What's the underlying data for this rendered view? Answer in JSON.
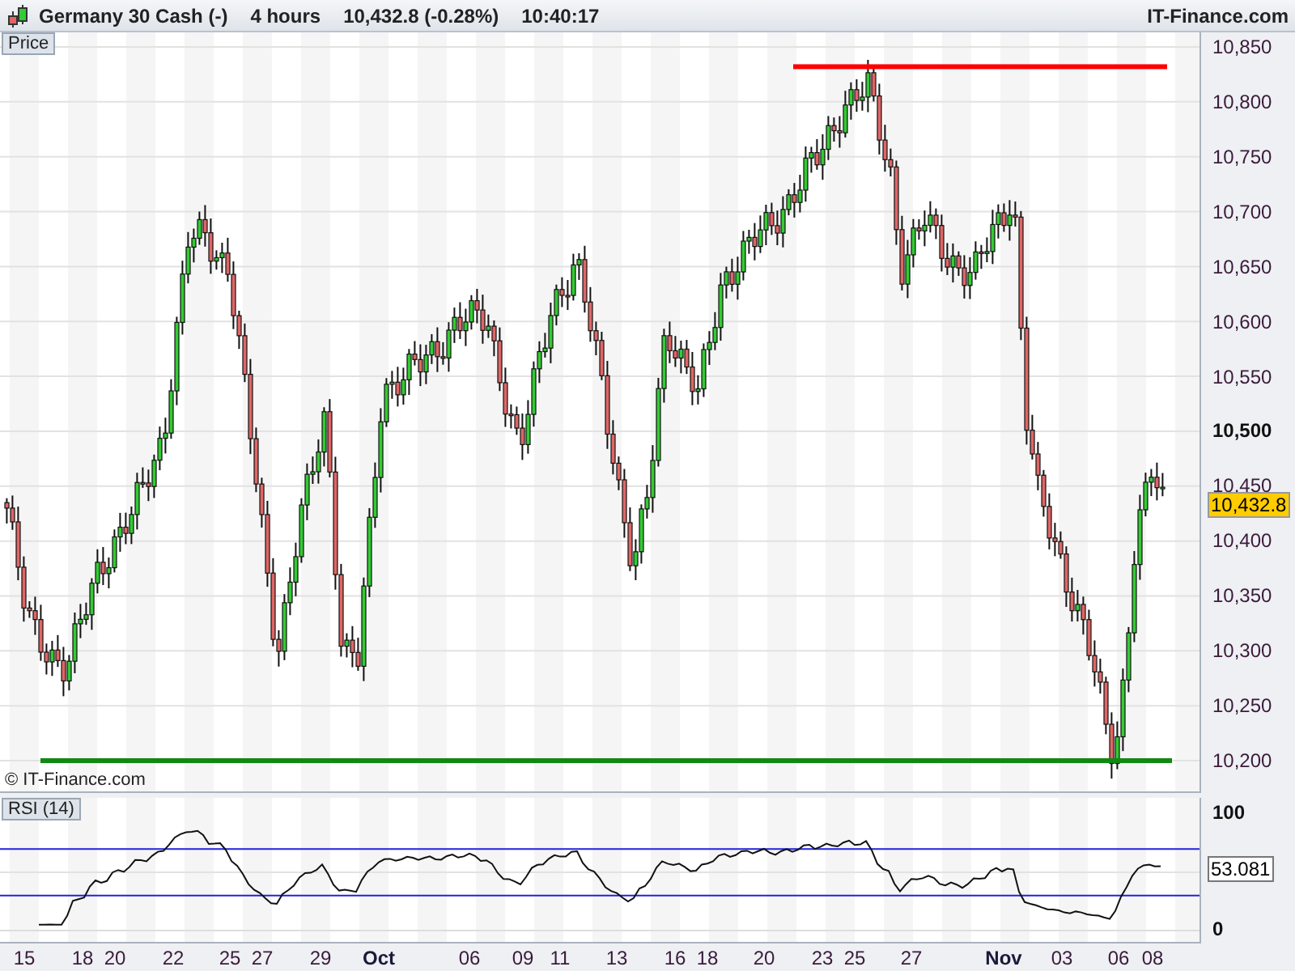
{
  "header": {
    "instrument": "Germany 30 Cash (-)",
    "timeframe": "4 hours",
    "quote": "10,432.8 (-0.28%)",
    "time": "10:40:17",
    "brand": "IT-Finance.com"
  },
  "price_panel": {
    "label": "Price",
    "copyright": "© IT-Finance.com",
    "current_price": "10,432.8",
    "y_ticks": [
      {
        "label": "10,850",
        "bold": false
      },
      {
        "label": "10,800",
        "bold": false
      },
      {
        "label": "10,750",
        "bold": false
      },
      {
        "label": "10,700",
        "bold": false
      },
      {
        "label": "10,650",
        "bold": false
      },
      {
        "label": "10,600",
        "bold": false
      },
      {
        "label": "10,550",
        "bold": false
      },
      {
        "label": "10,500",
        "bold": true
      },
      {
        "label": "10,450",
        "bold": false
      },
      {
        "label": "10,400",
        "bold": false
      },
      {
        "label": "10,350",
        "bold": false
      },
      {
        "label": "10,300",
        "bold": false
      },
      {
        "label": "10,250",
        "bold": false
      },
      {
        "label": "10,200",
        "bold": false
      }
    ]
  },
  "rsi_panel": {
    "label": "RSI (14)",
    "top_tick": "100",
    "bottom_tick": "0",
    "current_value": "53.081"
  },
  "x_axis": [
    {
      "label": "15",
      "kind": "day"
    },
    {
      "label": "18",
      "kind": "day"
    },
    {
      "label": "20",
      "kind": "day"
    },
    {
      "label": "22",
      "kind": "day"
    },
    {
      "label": "25",
      "kind": "day"
    },
    {
      "label": "27",
      "kind": "day"
    },
    {
      "label": "29",
      "kind": "day"
    },
    {
      "label": "Oct",
      "kind": "month"
    },
    {
      "label": "06",
      "kind": "day"
    },
    {
      "label": "09",
      "kind": "day"
    },
    {
      "label": "11",
      "kind": "day"
    },
    {
      "label": "13",
      "kind": "day"
    },
    {
      "label": "16",
      "kind": "day"
    },
    {
      "label": "18",
      "kind": "day"
    },
    {
      "label": "20",
      "kind": "day"
    },
    {
      "label": "23",
      "kind": "day"
    },
    {
      "label": "25",
      "kind": "day"
    },
    {
      "label": "27",
      "kind": "day"
    },
    {
      "label": "Nov",
      "kind": "month"
    },
    {
      "label": "03",
      "kind": "day"
    },
    {
      "label": "06",
      "kind": "day"
    },
    {
      "label": "08",
      "kind": "day"
    }
  ]
}
